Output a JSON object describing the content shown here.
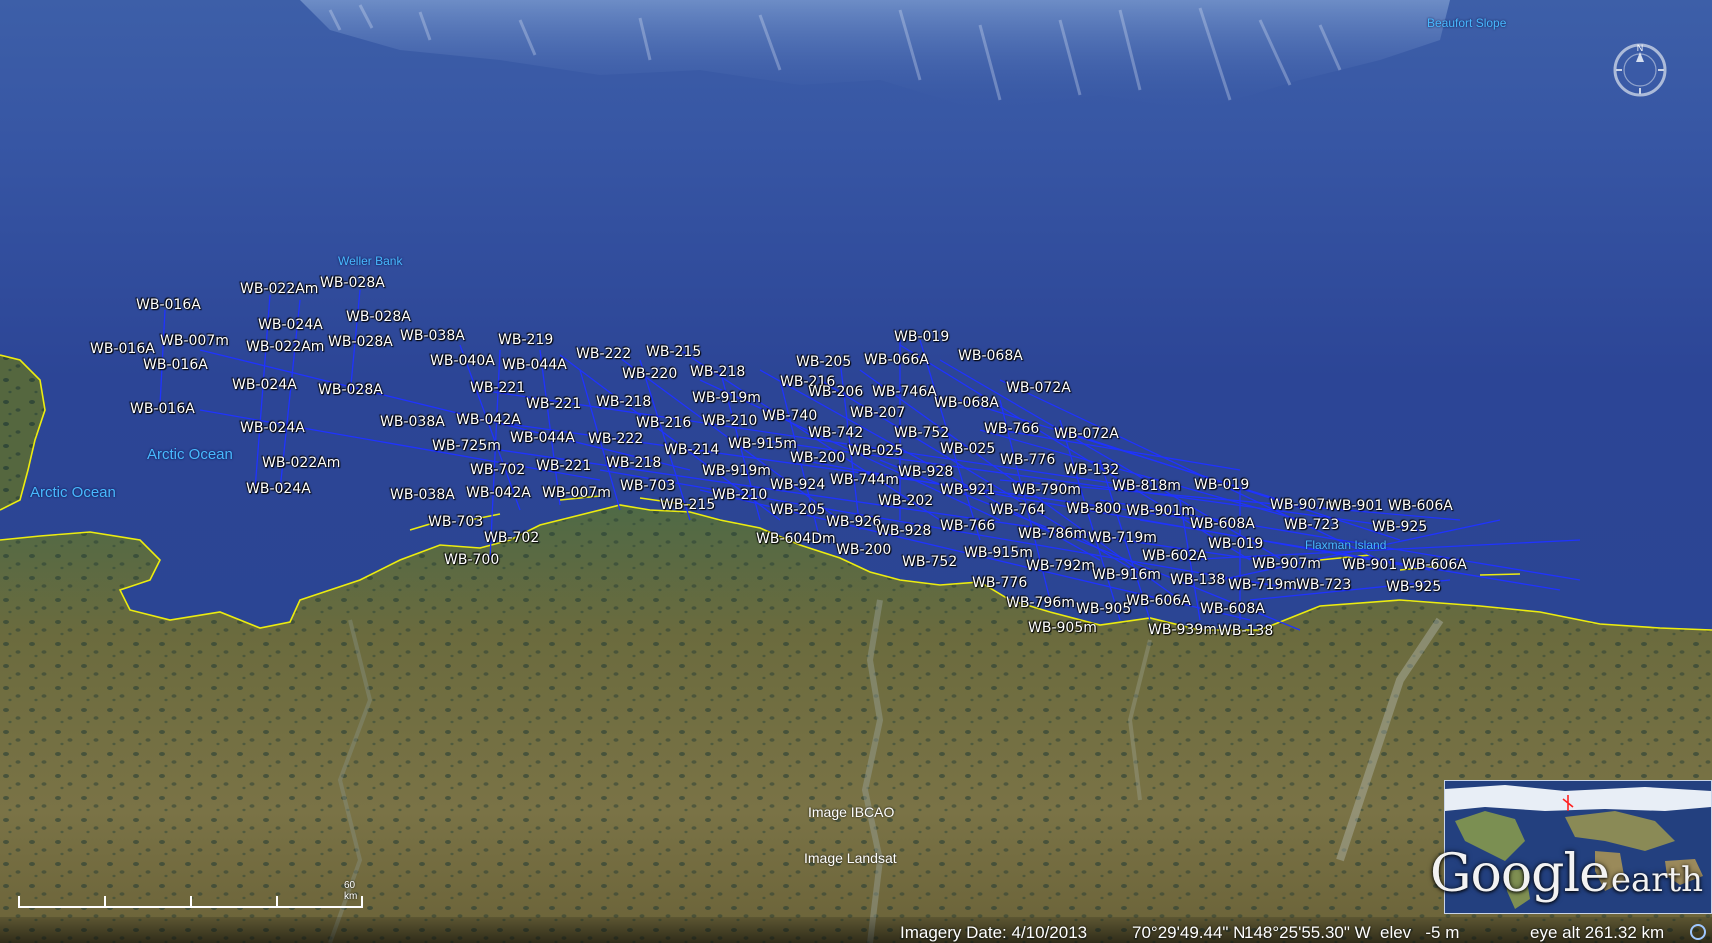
{
  "place_names": [
    {
      "text": "Beaufort Slope",
      "kind": "small"
    },
    {
      "text": "Weller Bank",
      "kind": "small"
    },
    {
      "text": "Arctic Ocean",
      "kind": "normal"
    },
    {
      "text": "Arctic Ocean",
      "kind": "normal"
    },
    {
      "text": "Flaxman Island",
      "kind": "small"
    }
  ],
  "track_labels": [
    "WB-016A",
    "WB-022Am",
    "WB-028A",
    "WB-024A",
    "WB-028A",
    "WB-016A",
    "WB-007m",
    "WB-022Am",
    "WB-028A",
    "WB-038A",
    "WB-016A",
    "WB-040A",
    "WB-044A",
    "WB-219",
    "WB-222",
    "WB-215",
    "WB-024A",
    "WB-218",
    "WB-220",
    "WB-028A",
    "WB-221",
    "WB-205",
    "WB-066A",
    "WB-068A",
    "WB-019",
    "WB-216",
    "WB-016A",
    "WB-919m",
    "WB-206",
    "WB-746A",
    "WB-072A",
    "WB-221",
    "WB-218",
    "WB-068A",
    "WB-038A",
    "WB-042A",
    "WB-216",
    "WB-210",
    "WB-740",
    "WB-207",
    "WB-024A",
    "WB-766",
    "WB-072A",
    "WB-044A",
    "WB-222",
    "WB-742",
    "WB-752",
    "WB-725m",
    "WB-915m",
    "WB-214",
    "WB-025",
    "WB-025",
    "WB-200",
    "WB-776",
    "WB-022Am",
    "WB-221",
    "WB-218",
    "WB-702",
    "WB-919m",
    "WB-928",
    "WB-132",
    "WB-744m",
    "WB-024A",
    "WB-703",
    "WB-924",
    "WB-921",
    "WB-790m",
    "WB-818m",
    "WB-019",
    "WB-038A",
    "WB-042A",
    "WB-007m",
    "WB-210",
    "WB-202",
    "WB-215",
    "WB-764",
    "WB-800",
    "WB-907m",
    "WB-901m",
    "WB-901",
    "WB-606A",
    "WB-205",
    "WB-703",
    "WB-926",
    "WB-608A",
    "WB-723",
    "WB-766",
    "WB-928",
    "WB-925",
    "WB-604Dm",
    "WB-702",
    "WB-786m",
    "WB-719m",
    "WB-019",
    "WB-200",
    "WB-752",
    "WB-915m",
    "WB-602A",
    "WB-700",
    "WB-907m",
    "WB-901",
    "WB-606A",
    "WB-792m",
    "WB-916m",
    "WB-776",
    "WB-138",
    "WB-719m",
    "WB-723",
    "WB-925",
    "WB-796m",
    "WB-905",
    "WB-606A",
    "WB-608A",
    "WB-905m",
    "WB-939m",
    "WB-138"
  ],
  "credits": [
    "Image IBCAO",
    "Image Landsat"
  ],
  "scale": {
    "label": "60 km"
  },
  "status_bar": {
    "imagery_date": "Imagery Date: 4/10/2013",
    "lat": "70°29'49.44\" N",
    "lon": "148°25'55.30\" W",
    "elev": "elev   -5 m",
    "eye_alt": "eye alt 261.32 km"
  },
  "compass": {
    "north_label": "N"
  },
  "logo": {
    "google": "Google",
    "earth": "earth"
  },
  "colors": {
    "track": "#1f33ff",
    "coastline": "#f0f000",
    "ocean": "#2f4a9c",
    "land": "#6f6a3c"
  }
}
